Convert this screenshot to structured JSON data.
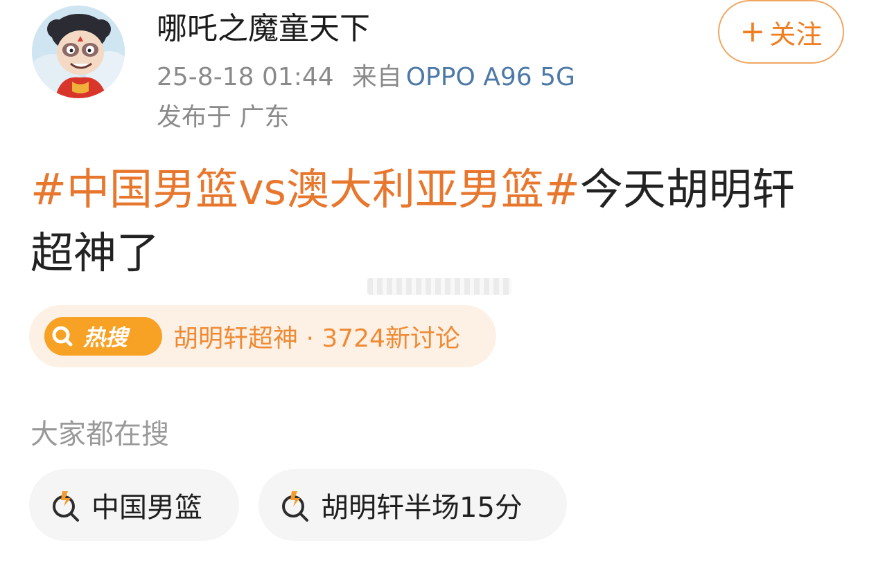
{
  "post": {
    "author": {
      "name": "哪吒之魔童天下",
      "avatar_icon": "nezha-avatar-icon"
    },
    "meta": {
      "timestamp": "25-8-18 01:44",
      "source_prefix": "来自",
      "device": "OPPO A96 5G",
      "location": "发布于 广东"
    },
    "follow_button": {
      "plus": "+",
      "label": "关注"
    },
    "content": {
      "topic": "#中国男篮vs澳大利亚男篮#",
      "text": "今天胡明轩超神了"
    }
  },
  "hot_search": {
    "badge_label": "热搜",
    "text": "胡明轩超神 · 3724新讨论"
  },
  "suggestions": {
    "title": "大家都在搜",
    "items": [
      {
        "label": "中国男篮",
        "icon": "hot-search-icon"
      },
      {
        "label": "胡明轩半场15分",
        "icon": "hot-search-icon"
      }
    ]
  },
  "colors": {
    "accent_orange": "#e8772e",
    "follow_orange": "#f07d1e",
    "hot_badge": "#f7a125",
    "hot_pill_bg": "#fdf1e6",
    "device_link": "#4d79a8",
    "meta_gray": "#8a8a8a",
    "suggestion_bg": "#f5f5f5"
  }
}
